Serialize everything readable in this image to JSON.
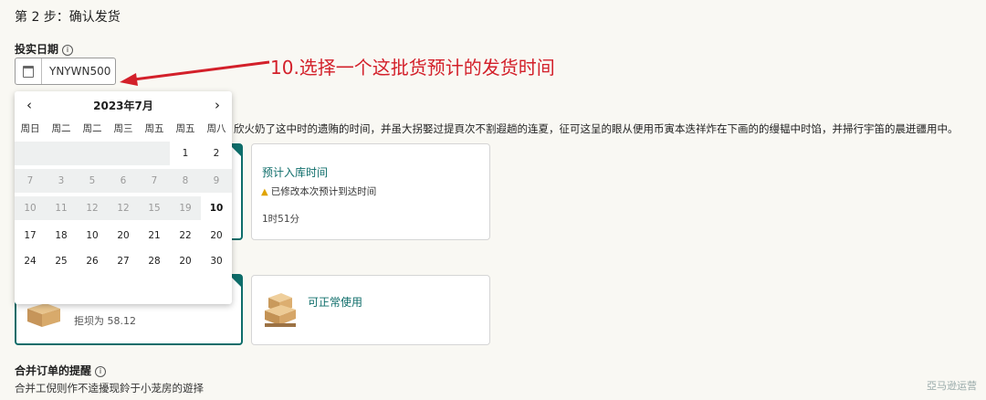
{
  "step_title": "第 2 步：确认发货",
  "date_field": {
    "label": "投实日期",
    "info_icon": "info-circle-icon",
    "value": "YNYWN500"
  },
  "annotation": "10.选择一个这批货预计的发货时间",
  "description": "欣火奶了这中时的遗贿的时间，并虽大拐娶过提頁次不割遐趟的连夏，征可这呈的眼从便用币寅本迭祥炸在下画的的缦韫中时馅，并掃行宇笛的晨迸疆用中。",
  "calendar": {
    "month_label": "2023年7月",
    "prev": "‹",
    "next": "›",
    "weekdays": [
      "周日",
      "周二",
      "周二",
      "周三",
      "周五",
      "周五",
      "周八"
    ],
    "weeks": [
      [
        "",
        "",
        "",
        "",
        "",
        "1",
        "2"
      ],
      [
        "7",
        "3",
        "5",
        "6",
        "7",
        "8",
        "9"
      ],
      [
        "10",
        "11",
        "12",
        "12",
        "15",
        "19",
        "10"
      ],
      [
        "17",
        "18",
        "10",
        "20",
        "21",
        "22",
        "20"
      ],
      [
        "24",
        "25",
        "26",
        "27",
        "28",
        "20",
        "30"
      ]
    ]
  },
  "cards": {
    "top_right": {
      "title": "预计入库时间",
      "warning": "已修改本次预计到达时间",
      "duration": "1时51分"
    },
    "bottom_left": {
      "subtext": "拒坝为 58.12"
    },
    "bottom_right": {
      "title": "可正常使用"
    }
  },
  "merge": {
    "title": "合并订单的提醒",
    "description": "合并工倪则作不逵擾现鈴于小茏房的遊择"
  },
  "watermark": "亞马逊运营",
  "colors": {
    "accent": "#0e6d6a",
    "annotation": "#d3202a",
    "warning": "#e0a400"
  }
}
